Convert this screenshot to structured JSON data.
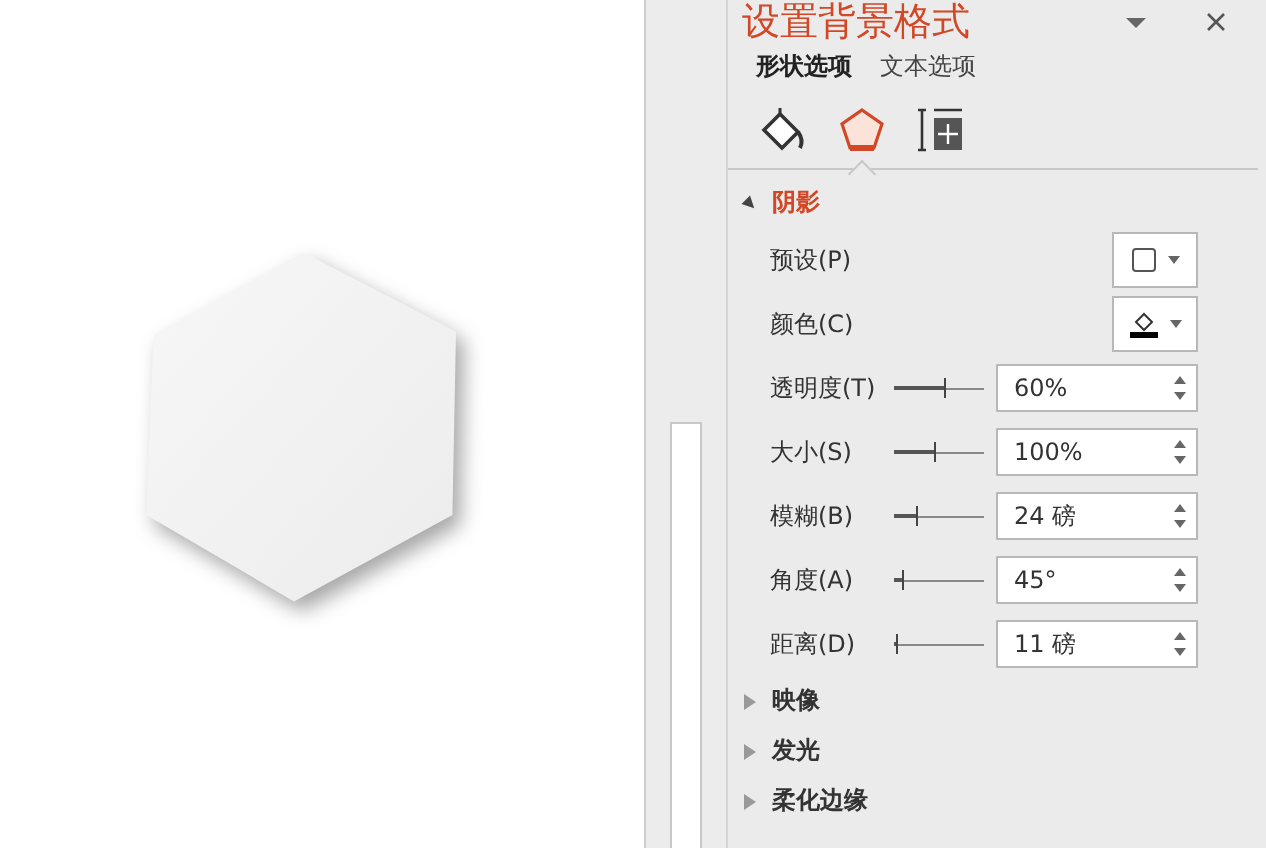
{
  "panel": {
    "title": "设置背景格式",
    "option_tabs": [
      {
        "label": "形状选项",
        "selected": true
      },
      {
        "label": "文本选项",
        "selected": false
      }
    ],
    "icon_tabs": [
      {
        "kind": "fill",
        "selected": false
      },
      {
        "kind": "effects",
        "selected": true
      },
      {
        "kind": "size",
        "selected": false
      }
    ],
    "sections": [
      {
        "title": "阴影",
        "expanded": true,
        "rows": [
          {
            "kind": "preset",
            "label": "预设(P)"
          },
          {
            "kind": "color",
            "label": "颜色(C)"
          },
          {
            "kind": "spin",
            "label": "透明度(T)",
            "level": 0.58,
            "value": "60%"
          },
          {
            "kind": "spin",
            "label": "大小(S)",
            "level": 0.47,
            "value": "100%"
          },
          {
            "kind": "spin",
            "label": "模糊(B)",
            "level": 0.27,
            "value": "24 磅"
          },
          {
            "kind": "spin",
            "label": "角度(A)",
            "level": 0.11,
            "value": "45°"
          },
          {
            "kind": "spin",
            "label": "距离(D)",
            "level": 0.05,
            "value": "11 磅"
          }
        ]
      },
      {
        "title": "映像",
        "expanded": false
      },
      {
        "title": "发光",
        "expanded": false
      },
      {
        "title": "柔化边缘",
        "expanded": false
      }
    ]
  }
}
